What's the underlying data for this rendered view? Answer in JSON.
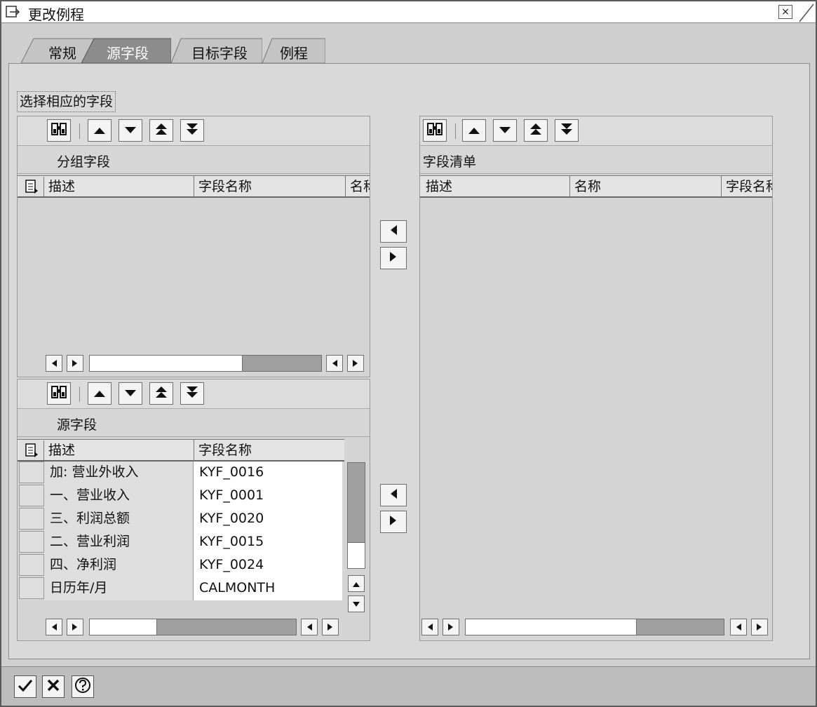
{
  "window": {
    "title": "更改例程",
    "close_label": "×"
  },
  "tabs": [
    {
      "label": "常规"
    },
    {
      "label": "源字段"
    },
    {
      "label": "目标字段"
    },
    {
      "label": "例程"
    }
  ],
  "group": {
    "label": "选择相应的字段"
  },
  "grouping_panel": {
    "caption": "分组字段",
    "columns": [
      "描述",
      "字段名称",
      "名称"
    ]
  },
  "source_panel": {
    "caption": "源字段",
    "columns": [
      "描述",
      "字段名称"
    ],
    "rows": [
      {
        "desc": "加: 营业外收入",
        "field": "KYF_0016"
      },
      {
        "desc": "一、营业收入",
        "field": "KYF_0001"
      },
      {
        "desc": "三、利润总额",
        "field": "KYF_0020"
      },
      {
        "desc": "二、营业利润",
        "field": "KYF_0015"
      },
      {
        "desc": "四、净利润",
        "field": "KYF_0024"
      },
      {
        "desc": "日历年/月",
        "field": "CALMONTH"
      }
    ]
  },
  "field_list_panel": {
    "caption": "字段清单",
    "columns": [
      "描述",
      "名称",
      "字段名称"
    ]
  },
  "colors": {
    "background": "#d9d9d9",
    "header": "#e4e4e4",
    "button": "#f4f4f4"
  },
  "icons": [
    "binoculars-icon",
    "arrow-up-icon",
    "arrow-down-icon",
    "arrow-top-icon",
    "arrow-bottom-icon",
    "arrow-left-icon",
    "arrow-right-icon",
    "check-icon",
    "cancel-icon",
    "help-icon"
  ]
}
